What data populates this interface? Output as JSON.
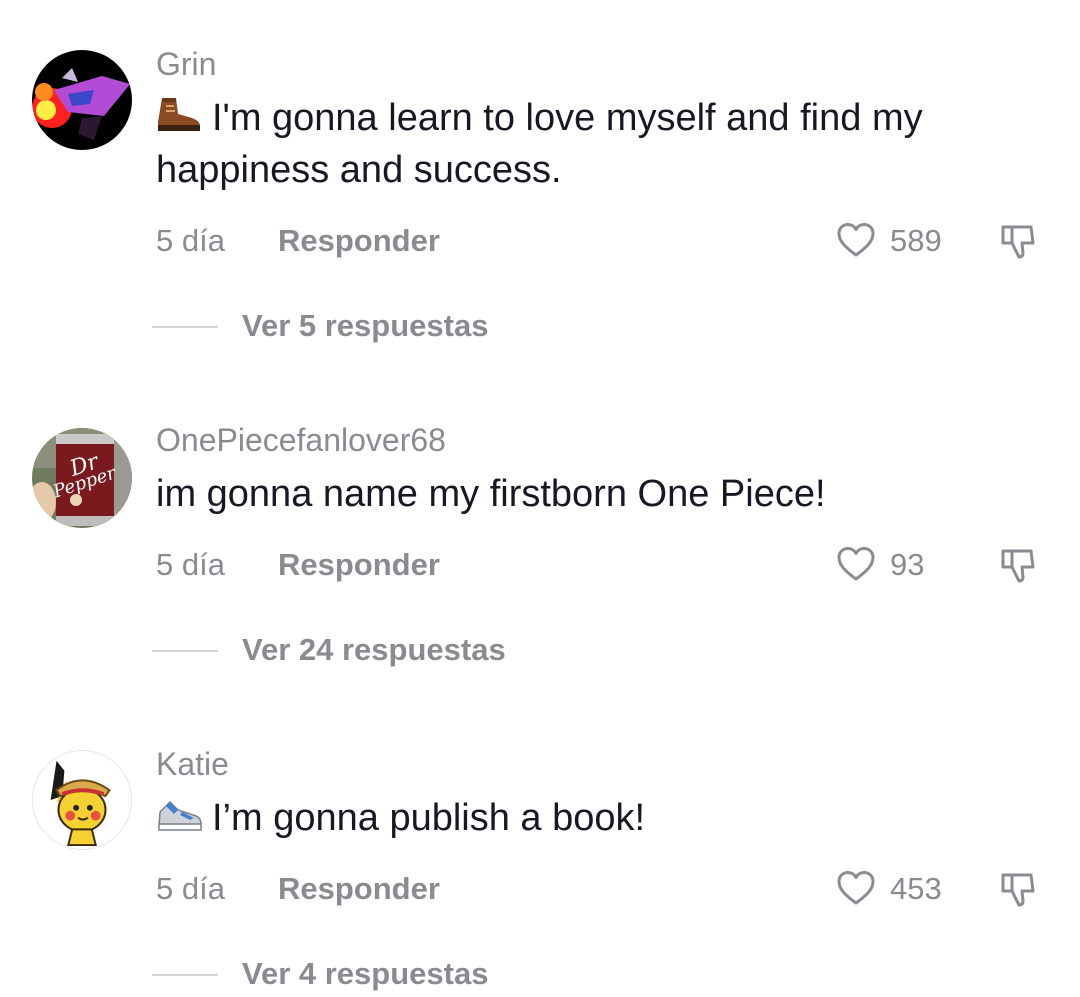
{
  "comments": [
    {
      "username": "Grin",
      "emoji_icon": "boot-emoji-icon",
      "text": "I'm gonna learn to love myself and find my happiness and success.",
      "time": "5 día",
      "reply_label": "Responder",
      "likes": "589",
      "view_replies": "Ver 5 respuestas"
    },
    {
      "username": "OnePiecefanlover68",
      "emoji_icon": "",
      "text": "im gonna name my firstborn One Piece!",
      "time": "5 día",
      "reply_label": "Responder",
      "likes": "93",
      "view_replies": "Ver 24 respuestas"
    },
    {
      "username": "Katie",
      "emoji_icon": "sneaker-emoji-icon",
      "text": "I’m gonna publish a book!",
      "time": "5 día",
      "reply_label": "Responder",
      "likes": "453",
      "view_replies": "Ver 4 respuestas"
    }
  ],
  "colors": {
    "text_primary": "#161823",
    "text_secondary": "#8a8b91",
    "divider": "#d0d1d3",
    "background": "#ffffff"
  }
}
